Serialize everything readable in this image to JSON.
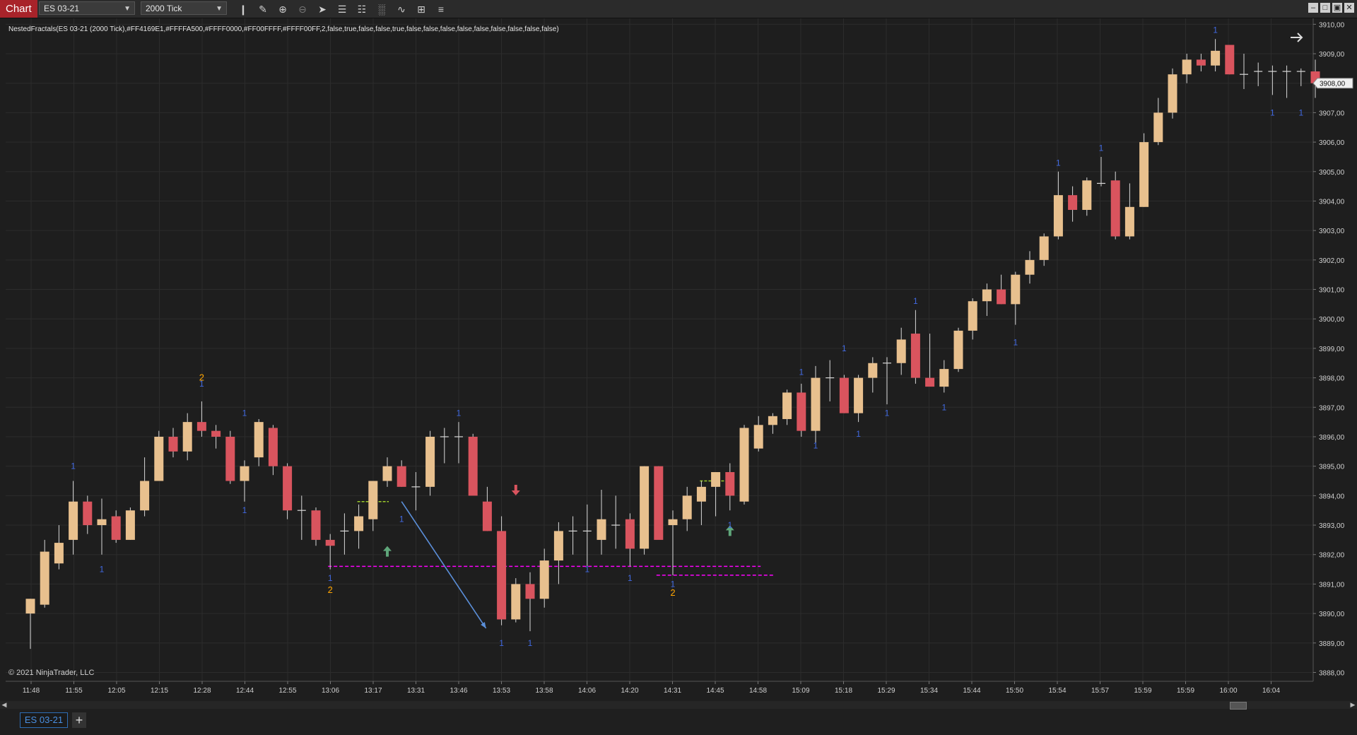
{
  "toolbar": {
    "chart_tab": "Chart",
    "instrument": "ES 03-21",
    "bar_type": "2000 Tick",
    "icons": [
      "bars-icon",
      "pencil-icon",
      "zoom-in-icon",
      "zoom-out-icon",
      "pointer-icon",
      "properties-icon",
      "templates-icon",
      "strategies-icon",
      "indicators-icon",
      "data-box-icon",
      "list-icon"
    ],
    "window_buttons": [
      "minimize-icon",
      "restore-icon",
      "maximize-icon",
      "close-icon"
    ]
  },
  "indicator_label": "NestedFractals(ES 03-21 (2000 Tick),#FF4169E1,#FFFFA500,#FFFF0000,#FF00FFFF,#FFFF00FF,2,false,true,false,false,true,false,false,false,false,false,false,false,false,false)",
  "copyright": "© 2021 NinjaTrader, LLC",
  "bottom_tab": "ES 03-21",
  "colors": {
    "up": "#e8c08e",
    "down": "#d9545e",
    "wick": "#d8d8d8",
    "grid": "#2c2c2c",
    "fractal1": "#4169e1",
    "fractal2": "#ffa500",
    "magenta": "#ff00ff",
    "green_dash": "#9ccc2a",
    "blue_arrow": "#5b8fd9",
    "bg": "#1e1e1e"
  },
  "chart_data": {
    "type": "candlestick",
    "y_axis": {
      "ylim": [
        3887.7,
        3910.2
      ],
      "ticks": [
        "3910,00",
        "3909,00",
        "3908,00",
        "3907,00",
        "3906,00",
        "3905,00",
        "3904,00",
        "3903,00",
        "3902,00",
        "3901,00",
        "3900,00",
        "3899,00",
        "3898,00",
        "3897,00",
        "3896,00",
        "3895,00",
        "3894,00",
        "3893,00",
        "3892,00",
        "3891,00",
        "3890,00",
        "3889,00",
        "3888,00"
      ],
      "current_price": "3908,00"
    },
    "x_labels": [
      "11:48",
      "11:55",
      "12:05",
      "12:15",
      "12:28",
      "12:44",
      "12:55",
      "13:06",
      "13:17",
      "13:31",
      "13:46",
      "13:53",
      "13:58",
      "14:06",
      "14:20",
      "14:31",
      "14:45",
      "14:58",
      "15:09",
      "15:18",
      "15:29",
      "15:34",
      "15:44",
      "15:50",
      "15:54",
      "15:57",
      "15:59",
      "15:59",
      "16:00",
      "16:04"
    ],
    "candles": [
      {
        "o": 3890.0,
        "h": 3890.5,
        "l": 3888.8,
        "c": 3890.5
      },
      {
        "o": 3890.3,
        "h": 3892.5,
        "l": 3890.2,
        "c": 3892.1
      },
      {
        "o": 3891.7,
        "h": 3893.0,
        "l": 3891.5,
        "c": 3892.4
      },
      {
        "o": 3892.5,
        "h": 3894.5,
        "l": 3892.0,
        "c": 3893.8
      },
      {
        "o": 3893.8,
        "h": 3894.0,
        "l": 3892.7,
        "c": 3893.0
      },
      {
        "o": 3893.0,
        "h": 3893.9,
        "l": 3892.0,
        "c": 3893.2
      },
      {
        "o": 3893.3,
        "h": 3893.5,
        "l": 3892.4,
        "c": 3892.5
      },
      {
        "o": 3892.5,
        "h": 3893.6,
        "l": 3892.5,
        "c": 3893.5
      },
      {
        "o": 3893.5,
        "h": 3895.3,
        "l": 3893.3,
        "c": 3894.5
      },
      {
        "o": 3894.5,
        "h": 3896.2,
        "l": 3894.5,
        "c": 3896.0
      },
      {
        "o": 3896.0,
        "h": 3896.3,
        "l": 3895.3,
        "c": 3895.5
      },
      {
        "o": 3895.5,
        "h": 3896.8,
        "l": 3895.2,
        "c": 3896.5
      },
      {
        "o": 3896.5,
        "h": 3897.2,
        "l": 3896.0,
        "c": 3896.2
      },
      {
        "o": 3896.2,
        "h": 3896.4,
        "l": 3895.6,
        "c": 3896.0
      },
      {
        "o": 3896.0,
        "h": 3896.2,
        "l": 3894.4,
        "c": 3894.5
      },
      {
        "o": 3894.5,
        "h": 3895.2,
        "l": 3893.8,
        "c": 3895.0
      },
      {
        "o": 3895.3,
        "h": 3896.6,
        "l": 3895.0,
        "c": 3896.5
      },
      {
        "o": 3896.3,
        "h": 3896.4,
        "l": 3894.7,
        "c": 3895.0
      },
      {
        "o": 3895.0,
        "h": 3895.1,
        "l": 3893.2,
        "c": 3893.5
      },
      {
        "o": 3893.5,
        "h": 3894.0,
        "l": 3892.5,
        "c": 3893.5
      },
      {
        "o": 3893.5,
        "h": 3893.6,
        "l": 3892.3,
        "c": 3892.5
      },
      {
        "o": 3892.5,
        "h": 3892.7,
        "l": 3891.5,
        "c": 3892.3
      },
      {
        "o": 3892.8,
        "h": 3893.4,
        "l": 3892.0,
        "c": 3892.8
      },
      {
        "o": 3892.8,
        "h": 3893.7,
        "l": 3892.2,
        "c": 3893.3
      },
      {
        "o": 3893.2,
        "h": 3894.3,
        "l": 3892.8,
        "c": 3894.5
      },
      {
        "o": 3894.5,
        "h": 3895.3,
        "l": 3894.3,
        "c": 3895.0
      },
      {
        "o": 3895.0,
        "h": 3895.2,
        "l": 3894.3,
        "c": 3894.3
      },
      {
        "o": 3894.3,
        "h": 3894.8,
        "l": 3893.5,
        "c": 3894.3
      },
      {
        "o": 3894.3,
        "h": 3896.2,
        "l": 3894.0,
        "c": 3896.0
      },
      {
        "o": 3896.0,
        "h": 3896.3,
        "l": 3895.1,
        "c": 3896.0
      },
      {
        "o": 3896.0,
        "h": 3896.5,
        "l": 3895.1,
        "c": 3896.0
      },
      {
        "o": 3896.0,
        "h": 3896.1,
        "l": 3894.1,
        "c": 3894.0
      },
      {
        "o": 3893.8,
        "h": 3894.3,
        "l": 3892.8,
        "c": 3892.8
      },
      {
        "o": 3892.8,
        "h": 3893.3,
        "l": 3889.6,
        "c": 3889.8
      },
      {
        "o": 3889.8,
        "h": 3891.2,
        "l": 3889.7,
        "c": 3891.0
      },
      {
        "o": 3891.0,
        "h": 3891.4,
        "l": 3889.4,
        "c": 3890.5
      },
      {
        "o": 3890.5,
        "h": 3892.2,
        "l": 3890.2,
        "c": 3891.8
      },
      {
        "o": 3891.8,
        "h": 3893.1,
        "l": 3891.0,
        "c": 3892.8
      },
      {
        "o": 3892.8,
        "h": 3893.3,
        "l": 3892.0,
        "c": 3892.8
      },
      {
        "o": 3892.8,
        "h": 3893.7,
        "l": 3891.6,
        "c": 3892.8
      },
      {
        "o": 3892.5,
        "h": 3894.2,
        "l": 3892.0,
        "c": 3893.2
      },
      {
        "o": 3893.0,
        "h": 3894.0,
        "l": 3892.2,
        "c": 3893.0
      },
      {
        "o": 3893.2,
        "h": 3893.4,
        "l": 3891.6,
        "c": 3892.2
      },
      {
        "o": 3892.2,
        "h": 3895.0,
        "l": 3892.0,
        "c": 3895.0
      },
      {
        "o": 3895.0,
        "h": 3895.0,
        "l": 3892.6,
        "c": 3892.5
      },
      {
        "o": 3893.0,
        "h": 3893.5,
        "l": 3891.3,
        "c": 3893.2
      },
      {
        "o": 3893.2,
        "h": 3894.3,
        "l": 3892.8,
        "c": 3894.0
      },
      {
        "o": 3893.8,
        "h": 3894.5,
        "l": 3893.0,
        "c": 3894.3
      },
      {
        "o": 3894.3,
        "h": 3894.8,
        "l": 3893.3,
        "c": 3894.8
      },
      {
        "o": 3894.8,
        "h": 3895.1,
        "l": 3893.5,
        "c": 3894.0
      },
      {
        "o": 3893.8,
        "h": 3896.4,
        "l": 3893.7,
        "c": 3896.3
      },
      {
        "o": 3895.6,
        "h": 3896.7,
        "l": 3895.5,
        "c": 3896.4
      },
      {
        "o": 3896.4,
        "h": 3896.8,
        "l": 3896.1,
        "c": 3896.7
      },
      {
        "o": 3896.6,
        "h": 3897.6,
        "l": 3896.4,
        "c": 3897.5
      },
      {
        "o": 3897.5,
        "h": 3897.8,
        "l": 3896.0,
        "c": 3896.2
      },
      {
        "o": 3896.2,
        "h": 3898.4,
        "l": 3895.8,
        "c": 3898.0
      },
      {
        "o": 3898.0,
        "h": 3898.6,
        "l": 3897.2,
        "c": 3898.0
      },
      {
        "o": 3898.0,
        "h": 3898.1,
        "l": 3896.8,
        "c": 3896.8
      },
      {
        "o": 3896.8,
        "h": 3898.1,
        "l": 3896.5,
        "c": 3898.0
      },
      {
        "o": 3898.0,
        "h": 3898.7,
        "l": 3897.5,
        "c": 3898.5
      },
      {
        "o": 3898.5,
        "h": 3898.7,
        "l": 3897.1,
        "c": 3898.5
      },
      {
        "o": 3898.5,
        "h": 3899.7,
        "l": 3898.1,
        "c": 3899.3
      },
      {
        "o": 3899.5,
        "h": 3900.3,
        "l": 3897.8,
        "c": 3898.0
      },
      {
        "o": 3898.0,
        "h": 3899.5,
        "l": 3897.8,
        "c": 3897.7
      },
      {
        "o": 3897.7,
        "h": 3898.6,
        "l": 3897.5,
        "c": 3898.3
      },
      {
        "o": 3898.3,
        "h": 3899.7,
        "l": 3898.2,
        "c": 3899.6
      },
      {
        "o": 3899.6,
        "h": 3900.7,
        "l": 3899.3,
        "c": 3900.6
      },
      {
        "o": 3900.6,
        "h": 3901.2,
        "l": 3900.1,
        "c": 3901.0
      },
      {
        "o": 3901.0,
        "h": 3901.5,
        "l": 3900.5,
        "c": 3900.5
      },
      {
        "o": 3900.5,
        "h": 3901.6,
        "l": 3899.8,
        "c": 3901.5
      },
      {
        "o": 3901.5,
        "h": 3902.3,
        "l": 3901.2,
        "c": 3902.0
      },
      {
        "o": 3902.0,
        "h": 3902.9,
        "l": 3901.8,
        "c": 3902.8
      },
      {
        "o": 3902.8,
        "h": 3905.0,
        "l": 3902.7,
        "c": 3904.2
      },
      {
        "o": 3904.2,
        "h": 3904.5,
        "l": 3903.3,
        "c": 3903.7
      },
      {
        "o": 3903.7,
        "h": 3904.8,
        "l": 3903.5,
        "c": 3904.7
      },
      {
        "o": 3904.6,
        "h": 3905.5,
        "l": 3904.5,
        "c": 3904.6
      },
      {
        "o": 3904.7,
        "h": 3905.0,
        "l": 3902.7,
        "c": 3902.8
      },
      {
        "o": 3902.8,
        "h": 3904.6,
        "l": 3902.7,
        "c": 3903.8
      },
      {
        "o": 3903.8,
        "h": 3906.3,
        "l": 3903.8,
        "c": 3906.0
      },
      {
        "o": 3906.0,
        "h": 3907.5,
        "l": 3905.9,
        "c": 3907.0
      },
      {
        "o": 3907.0,
        "h": 3908.5,
        "l": 3906.8,
        "c": 3908.3
      },
      {
        "o": 3908.3,
        "h": 3909.0,
        "l": 3908.0,
        "c": 3908.8
      },
      {
        "o": 3908.8,
        "h": 3909.0,
        "l": 3908.4,
        "c": 3908.6
      },
      {
        "o": 3908.6,
        "h": 3909.5,
        "l": 3908.4,
        "c": 3909.1
      },
      {
        "o": 3909.3,
        "h": 3909.3,
        "l": 3908.3,
        "c": 3908.3
      },
      {
        "o": 3908.3,
        "h": 3909.0,
        "l": 3907.8,
        "c": 3908.3
      },
      {
        "o": 3908.4,
        "h": 3908.7,
        "l": 3907.9,
        "c": 3908.4
      },
      {
        "o": 3908.4,
        "h": 3908.6,
        "l": 3907.6,
        "c": 3908.4
      },
      {
        "o": 3908.4,
        "h": 3908.6,
        "l": 3907.5,
        "c": 3908.4
      },
      {
        "o": 3908.4,
        "h": 3908.5,
        "l": 3907.9,
        "c": 3908.4
      },
      {
        "o": 3908.4,
        "h": 3908.8,
        "l": 3907.5,
        "c": 3908.0
      }
    ],
    "fractal_labels": [
      {
        "i": 3,
        "p": 3895.0,
        "t": "1",
        "k": 1
      },
      {
        "i": 5,
        "p": 3891.5,
        "t": "1",
        "k": 1
      },
      {
        "i": 12,
        "p": 3897.8,
        "t": "1",
        "k": 1
      },
      {
        "i": 12,
        "p": 3898.0,
        "t": "2",
        "k": 2
      },
      {
        "i": 15,
        "p": 3896.8,
        "t": "1",
        "k": 1
      },
      {
        "i": 15,
        "p": 3893.5,
        "t": "1",
        "k": 1
      },
      {
        "i": 21,
        "p": 3891.2,
        "t": "1",
        "k": 1
      },
      {
        "i": 21,
        "p": 3890.8,
        "t": "2",
        "k": 2
      },
      {
        "i": 26,
        "p": 3893.2,
        "t": "1",
        "k": 1
      },
      {
        "i": 30,
        "p": 3896.8,
        "t": "1",
        "k": 1
      },
      {
        "i": 33,
        "p": 3889.0,
        "t": "1",
        "k": 1
      },
      {
        "i": 35,
        "p": 3889.0,
        "t": "1",
        "k": 1
      },
      {
        "i": 39,
        "p": 3891.5,
        "t": "1",
        "k": 1
      },
      {
        "i": 42,
        "p": 3891.2,
        "t": "1",
        "k": 1
      },
      {
        "i": 45,
        "p": 3891.0,
        "t": "1",
        "k": 1
      },
      {
        "i": 45,
        "p": 3890.7,
        "t": "2",
        "k": 2
      },
      {
        "i": 49,
        "p": 3893.0,
        "t": "1",
        "k": 1
      },
      {
        "i": 54,
        "p": 3898.2,
        "t": "1",
        "k": 1
      },
      {
        "i": 55,
        "p": 3895.7,
        "t": "1",
        "k": 1
      },
      {
        "i": 57,
        "p": 3899.0,
        "t": "1",
        "k": 1
      },
      {
        "i": 58,
        "p": 3896.1,
        "t": "1",
        "k": 1
      },
      {
        "i": 60,
        "p": 3896.8,
        "t": "1",
        "k": 1
      },
      {
        "i": 62,
        "p": 3900.6,
        "t": "1",
        "k": 1
      },
      {
        "i": 64,
        "p": 3897.0,
        "t": "1",
        "k": 1
      },
      {
        "i": 69,
        "p": 3899.2,
        "t": "1",
        "k": 1
      },
      {
        "i": 72,
        "p": 3905.3,
        "t": "1",
        "k": 1
      },
      {
        "i": 75,
        "p": 3905.8,
        "t": "1",
        "k": 1
      },
      {
        "i": 83,
        "p": 3909.8,
        "t": "1",
        "k": 1
      },
      {
        "i": 87,
        "p": 3907.0,
        "t": "1",
        "k": 1
      },
      {
        "i": 89,
        "p": 3907.0,
        "t": "1",
        "k": 1
      }
    ],
    "annotations": {
      "magenta_lines": [
        {
          "i0": 21,
          "i1": 51,
          "p": 3891.6
        },
        {
          "i0": 44,
          "i1": 52,
          "p": 3891.3
        }
      ],
      "green_dashes": [
        {
          "i0": 23,
          "i1": 25,
          "p": 3893.8
        },
        {
          "i0": 47,
          "i1": 49,
          "p": 3894.5
        }
      ],
      "up_arrows": [
        {
          "i": 25,
          "p": 3892.1
        },
        {
          "i": 49,
          "p": 3892.8
        }
      ],
      "down_arrows": [
        {
          "i": 34,
          "p": 3894.2
        }
      ],
      "blue_arrow": {
        "i0": 26,
        "p0": 3893.8,
        "i1": 33,
        "p1": 3889.5
      }
    },
    "title": "",
    "xlabel": "",
    "ylabel": "",
    "grid": true
  }
}
